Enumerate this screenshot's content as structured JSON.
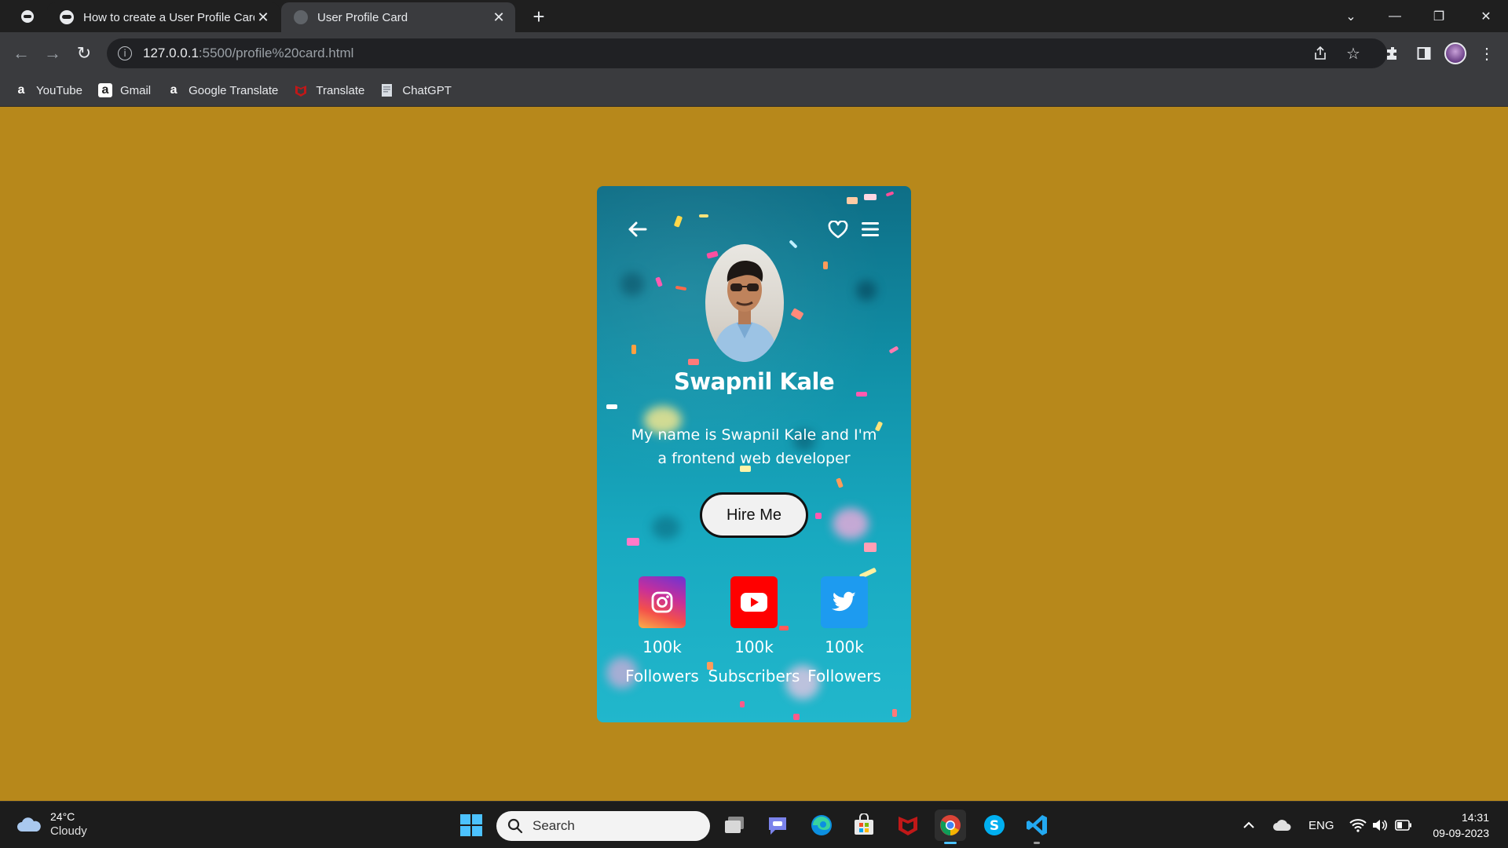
{
  "browser": {
    "tabs": [
      {
        "title": "How to create a User Profile Card",
        "active": false
      },
      {
        "title": "User Profile Card",
        "active": true
      }
    ],
    "address": {
      "host": "127.0.0.1",
      "path": ":5500/profile%20card.html"
    },
    "bookmarks": [
      {
        "label": "YouTube",
        "icon": "amazon-a-icon"
      },
      {
        "label": "Gmail",
        "icon": "amazon-a-icon"
      },
      {
        "label": "Google Translate",
        "icon": "amazon-a-icon"
      },
      {
        "label": "Translate",
        "icon": "mcafee-icon"
      },
      {
        "label": "ChatGPT",
        "icon": "page-icon"
      }
    ]
  },
  "page": {
    "background_color": "#b7881b",
    "profile": {
      "name": "Swapnil Kale",
      "bio": "My name is Swapnil Kale and I'm a frontend web developer",
      "hire_button": "Hire Me"
    },
    "socials": [
      {
        "network": "instagram",
        "count": "100k",
        "label": "Followers",
        "color": "#e1306c"
      },
      {
        "network": "youtube",
        "count": "100k",
        "label": "Subscribers",
        "color": "#ff0000"
      },
      {
        "network": "twitter",
        "count": "100k",
        "label": "Followers",
        "color": "#1da1f2"
      }
    ]
  },
  "taskbar": {
    "weather": {
      "temp": "24°C",
      "condition": "Cloudy"
    },
    "search_placeholder": "Search",
    "language": "ENG",
    "time": "14:31",
    "date": "09-09-2023"
  }
}
